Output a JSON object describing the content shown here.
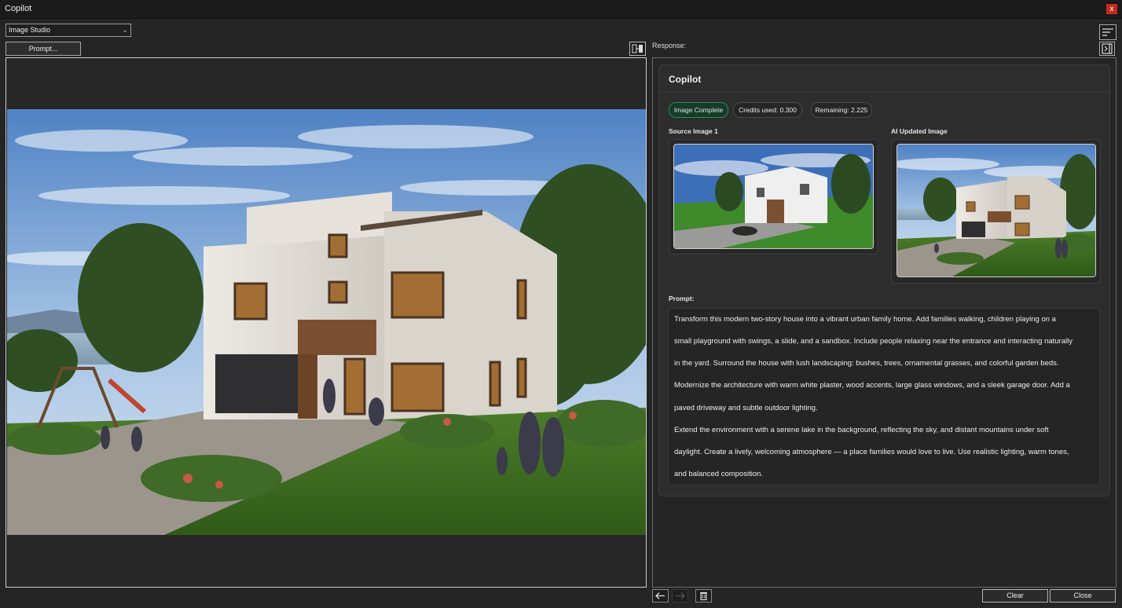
{
  "window": {
    "title": "Copilot",
    "close_glyph": "x"
  },
  "toolbar": {
    "mode_select": {
      "value": "Image Studio"
    },
    "prompt_button": "Prompt..."
  },
  "response": {
    "label": "Response:",
    "card_title": "Copilot",
    "badges": {
      "status": "Image Complete",
      "credits": "Credits used: 0.300",
      "remaining": "Remaining: 2.225"
    },
    "source_label": "Source Image 1",
    "updated_label": "AI Updated Image",
    "prompt_label": "Prompt:",
    "prompt_lines": [
      "Transform this modern two-story house into a vibrant urban family home. Add families walking, children playing on a",
      "small playground with swings, a slide, and a sandbox. Include people relaxing near the entrance and interacting naturally",
      " in the yard. Surround the house with lush landscaping: bushes, trees, ornamental grasses, and colorful garden beds.",
      "Modernize the architecture with warm white plaster, wood accents, large glass windows, and a sleek garage door. Add a",
      "paved driveway and subtle outdoor lighting.",
      "Extend the environment with a serene lake in the background, reflecting the sky, and distant mountains under soft",
      "daylight. Create a lively, welcoming atmosphere — a place families would love to live. Use realistic lighting, warm tones,",
      "and balanced composition."
    ]
  },
  "footer": {
    "clear_label": "Clear",
    "close_label": "Close"
  },
  "icons": {
    "back": "arrow-left-icon",
    "forward": "arrow-right-icon",
    "delete": "trash-icon",
    "sort": "sort-lines-icon",
    "collapse": "panel-collapse-icon",
    "swap": "swap-panels-icon"
  },
  "colors": {
    "background": "#252525",
    "title_bar": "#1b1b1b",
    "close_red": "#c42b1c",
    "status_green": "#2f8a5a",
    "card": "#2d2d2d"
  }
}
